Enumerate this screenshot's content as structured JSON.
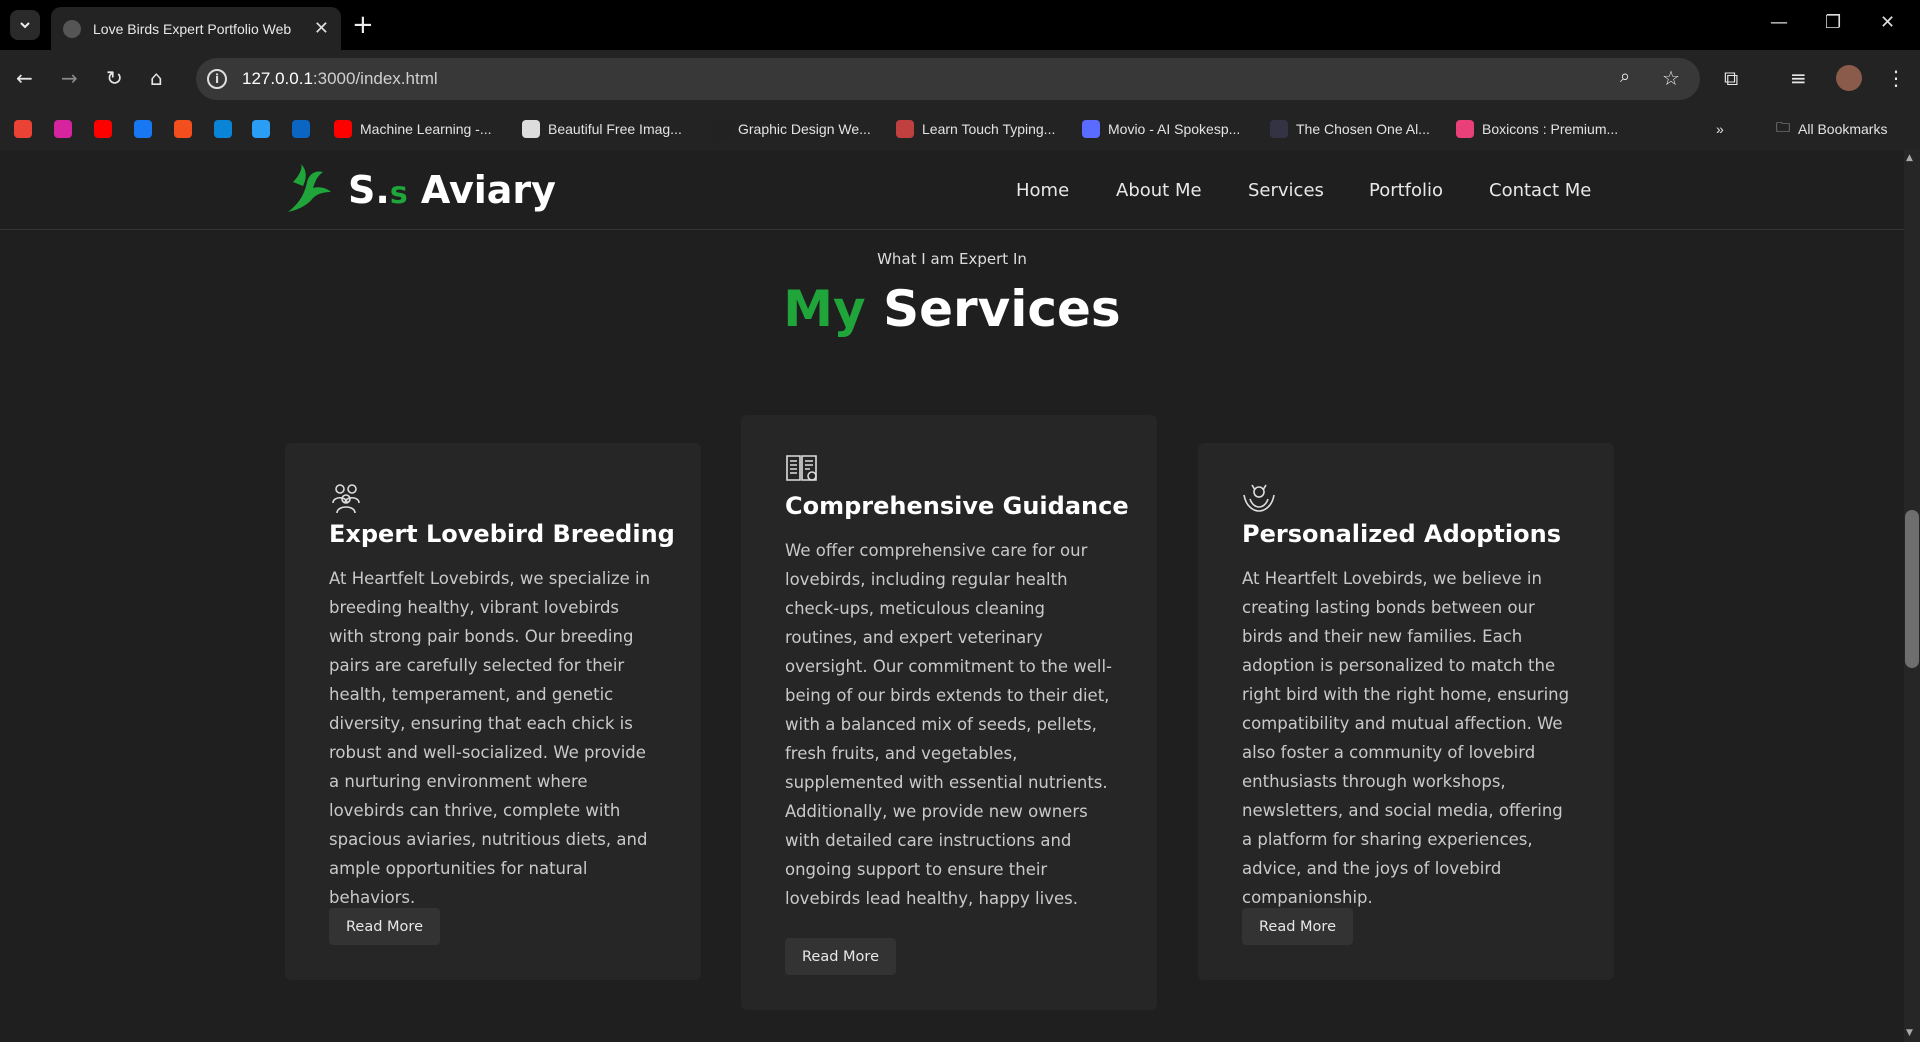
{
  "browser": {
    "tab_title": "Love Birds Expert Portfolio Web",
    "url_host": "127.0.0.1",
    "url_rest": ":3000/index.html",
    "bookmarks": [
      {
        "label": "",
        "icon": "gmail-icon",
        "color": "#ea4335"
      },
      {
        "label": "",
        "icon": "instagram-icon",
        "color": "#d6249f"
      },
      {
        "label": "",
        "icon": "youtube-icon",
        "color": "#ff0000"
      },
      {
        "label": "",
        "icon": "facebook-icon",
        "color": "#1877f2"
      },
      {
        "label": "",
        "icon": "figma-icon",
        "color": "#f24e1e"
      },
      {
        "label": "",
        "icon": "onedrive-icon",
        "color": "#0a84d6"
      },
      {
        "label": "",
        "icon": "bird-icon",
        "color": "#2a9df4"
      },
      {
        "label": "",
        "icon": "linkedin-icon",
        "color": "#0a66c2"
      },
      {
        "label": "Machine Learning -...",
        "icon": "youtube-icon",
        "color": "#ff0000"
      },
      {
        "label": "Beautiful Free Imag...",
        "icon": "unsplash-icon",
        "color": "#dddddd"
      },
      {
        "label": "Graphic Design We...",
        "icon": "design-icon",
        "color": "#222222"
      },
      {
        "label": "Learn Touch Typing...",
        "icon": "typing-icon",
        "color": "#c04040"
      },
      {
        "label": "Movio - AI Spokesp...",
        "icon": "movio-icon",
        "color": "#5a6cff"
      },
      {
        "label": "The Chosen One Al...",
        "icon": "chosen-icon",
        "color": "#334"
      },
      {
        "label": "Boxicons : Premium...",
        "icon": "boxicons-icon",
        "color": "#e9407a"
      }
    ],
    "all_bookmarks": "All Bookmarks"
  },
  "header": {
    "logo_prefix": "S.",
    "logo_s": "s",
    "logo_suffix": " Aviary",
    "nav": [
      "Home",
      "About Me",
      "Services",
      "Portfolio",
      "Contact Me"
    ]
  },
  "section": {
    "subtitle": "What I am Expert In",
    "title_green": "My",
    "title_white": " Services"
  },
  "cards": [
    {
      "icon": "breeding-pair-icon",
      "title": "Expert Lovebird Breeding",
      "body": "At Heartfelt Lovebirds, we specialize in breeding healthy, vibrant lovebirds with strong pair bonds. Our breeding pairs are carefully selected for their health, temperament, and genetic diversity, ensuring that each chick is robust and well-socialized. We provide a nurturing environment where lovebirds can thrive, complete with spacious aviaries, nutritious diets, and ample opportunities for natural behaviors.",
      "button": "Read More"
    },
    {
      "icon": "guide-book-icon",
      "title": "Comprehensive Guidance",
      "body": "We offer comprehensive care for our lovebirds, including regular health check-ups, meticulous cleaning routines, and expert veterinary oversight. Our commitment to the well-being of our birds extends to their diet, with a balanced mix of seeds, pellets, fresh fruits, and vegetables, supplemented with essential nutrients. Additionally, we provide new owners with detailed care instructions and ongoing support to ensure their lovebirds lead healthy, happy lives.",
      "button": "Read More"
    },
    {
      "icon": "adoption-hands-icon",
      "title": "Personalized Adoptions",
      "body": "At Heartfelt Lovebirds, we believe in creating lasting bonds between our birds and their new families. Each adoption is personalized to match the right bird with the right home, ensuring compatibility and mutual affection. We also foster a community of lovebird enthusiasts through workshops, newsletters, and social media, offering a platform for sharing experiences, advice, and the joys of lovebird companionship.",
      "button": "Read More"
    }
  ],
  "colors": {
    "accent": "#1fa53a",
    "background": "#1f1f1f",
    "card": "#262626"
  }
}
